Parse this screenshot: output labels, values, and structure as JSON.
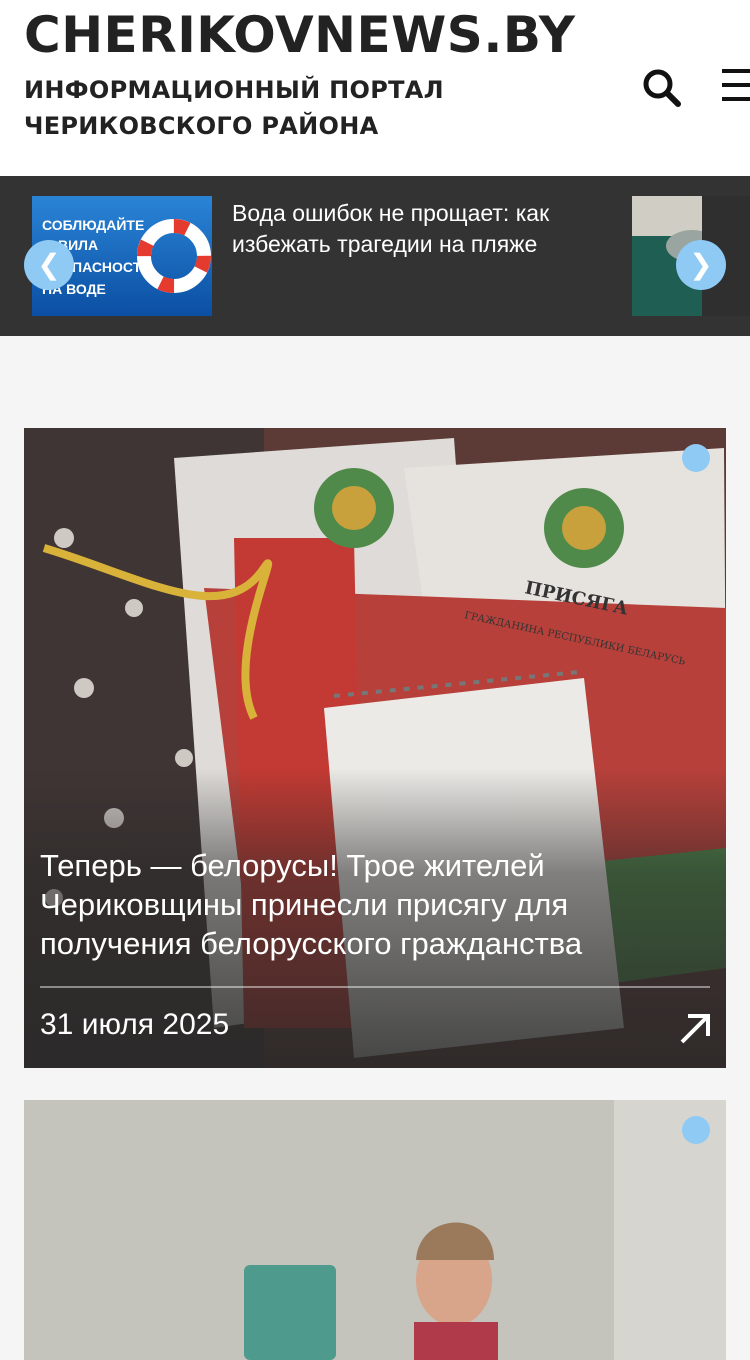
{
  "header": {
    "site_title": "CHERIKOVNEWS.BY",
    "site_subtitle_line1": "ИНФОРМАЦИОННЫЙ ПОРТАЛ",
    "site_subtitle_line2": "ЧЕРИКОВСКОГО РАЙОНА"
  },
  "slider": {
    "current_title": "Вода ошибок не прощает: как избежать трагедии на пляже",
    "thumb_text_lines": [
      "СОБЛЮДАЙТЕ",
      "ВИЛА",
      "ПАСНОСТИ",
      "НА ВОДЕ"
    ],
    "prev_label": "❮",
    "next_label": "❯"
  },
  "articles": [
    {
      "title": "Теперь — белорусы! Трое жителей Чериковщины принесли присягу для получения белорусского гражданства",
      "date": "31 июля 2025",
      "image_texts": [
        "ПРИСЯГА",
        "ГРАЖДАНИНА РЕСПУБЛИКИ БЕЛАРУСЬ"
      ]
    },
    {
      "title": "",
      "date": ""
    }
  ],
  "colors": {
    "accent": "#8fcaf5",
    "header_bg": "#ffffff",
    "slider_bg": "#333333",
    "page_bg": "#f5f5f5",
    "text_dark": "#222222"
  },
  "icons": {
    "search": "search-icon",
    "menu": "menu-icon",
    "prev": "chevron-left-icon",
    "next": "chevron-right-icon",
    "open_article": "arrow-up-right-icon"
  }
}
